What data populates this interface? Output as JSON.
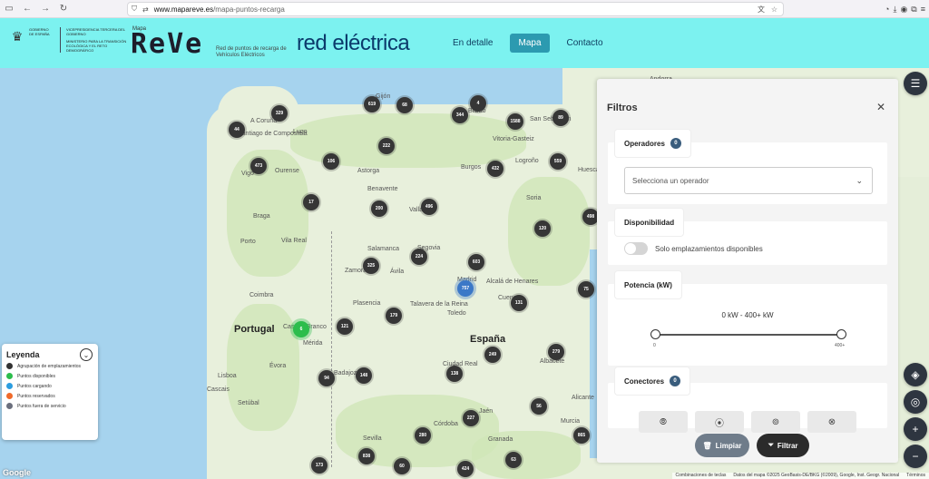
{
  "browser": {
    "url_host": "www.mapareve.es",
    "url_path": "/mapa-puntos-recarga"
  },
  "header": {
    "gov_text": "GOBIERNO DE ESPAÑA",
    "gov_sub": "VICEPRESIDENCIA TERCERA DEL GOBIERNO",
    "ministry": "MINISTERIO PARA LA TRANSICIÓN ECOLÓGICA Y EL RETO DEMOGRÁFICO",
    "mapa_label": "Mapa",
    "reve_logo": "ReVe",
    "reve_sub": "Red de puntos de recarga de Vehículos Eléctricos",
    "ree_logo": "red eléctrica",
    "nav": [
      {
        "label": "En detalle",
        "active": false
      },
      {
        "label": "Mapa",
        "active": true
      },
      {
        "label": "Contacto",
        "active": false
      }
    ]
  },
  "map": {
    "places": [
      {
        "name": "A Coruña",
        "big": false
      },
      {
        "name": "Santiago de Compostela",
        "big": false
      },
      {
        "name": "Lugo",
        "big": false
      },
      {
        "name": "Ourense",
        "big": false
      },
      {
        "name": "Vigo",
        "big": false
      },
      {
        "name": "Gijón",
        "big": false
      },
      {
        "name": "Astorga",
        "big": false
      },
      {
        "name": "Braga",
        "big": false
      },
      {
        "name": "Porto",
        "big": false
      },
      {
        "name": "Vila Real",
        "big": false
      },
      {
        "name": "Bilbao",
        "big": false
      },
      {
        "name": "San Sebastián",
        "big": false
      },
      {
        "name": "Vitoria-Gasteiz",
        "big": false
      },
      {
        "name": "Logroño",
        "big": false
      },
      {
        "name": "Burgos",
        "big": false
      },
      {
        "name": "Benavente",
        "big": false
      },
      {
        "name": "Salamanca",
        "big": false
      },
      {
        "name": "Zamora",
        "big": false
      },
      {
        "name": "Madrid",
        "big": false
      },
      {
        "name": "Alcalá de Henares",
        "big": false
      },
      {
        "name": "Toledo",
        "big": false
      },
      {
        "name": "Talavera de la Reina",
        "big": false
      },
      {
        "name": "Plasencia",
        "big": false
      },
      {
        "name": "Coimbra",
        "big": false
      },
      {
        "name": "Portugal",
        "big": true
      },
      {
        "name": "España",
        "big": true
      },
      {
        "name": "Castelo Branco",
        "big": false
      },
      {
        "name": "Ciudad Real",
        "big": false
      },
      {
        "name": "Albacete",
        "big": false
      },
      {
        "name": "Badajoz",
        "big": false
      },
      {
        "name": "Lisboa",
        "big": false
      },
      {
        "name": "Cascais",
        "big": false
      },
      {
        "name": "Setúbal",
        "big": false
      },
      {
        "name": "Évora",
        "big": false
      },
      {
        "name": "Córdoba",
        "big": false
      },
      {
        "name": "Jaén",
        "big": false
      },
      {
        "name": "Granada",
        "big": false
      },
      {
        "name": "Murcia",
        "big": false
      },
      {
        "name": "Sevilla",
        "big": false
      },
      {
        "name": "Alicante",
        "big": false
      },
      {
        "name": "Mérida",
        "big": false
      },
      {
        "name": "Valladolid",
        "big": false
      },
      {
        "name": "Segovia",
        "big": false
      },
      {
        "name": "Cuenca",
        "big": false
      },
      {
        "name": "Soria",
        "big": false
      },
      {
        "name": "Huesca",
        "big": false
      },
      {
        "name": "Andorra",
        "big": false
      },
      {
        "name": "Ávila",
        "big": false
      }
    ],
    "clusters": [
      {
        "label": "619",
        "kind": "dark"
      },
      {
        "label": "68",
        "kind": "dark"
      },
      {
        "label": "4",
        "kind": "dark"
      },
      {
        "label": "329",
        "kind": "dark"
      },
      {
        "label": "344",
        "kind": "dark"
      },
      {
        "label": "1588",
        "kind": "dark"
      },
      {
        "label": "89",
        "kind": "dark"
      },
      {
        "label": "44",
        "kind": "dark"
      },
      {
        "label": "222",
        "kind": "dark"
      },
      {
        "label": "473",
        "kind": "dark"
      },
      {
        "label": "106",
        "kind": "dark"
      },
      {
        "label": "432",
        "kind": "dark"
      },
      {
        "label": "559",
        "kind": "dark"
      },
      {
        "label": "17",
        "kind": "dark"
      },
      {
        "label": "200",
        "kind": "dark"
      },
      {
        "label": "496",
        "kind": "dark"
      },
      {
        "label": "498",
        "kind": "dark"
      },
      {
        "label": "120",
        "kind": "dark"
      },
      {
        "label": "224",
        "kind": "dark"
      },
      {
        "label": "325",
        "kind": "dark"
      },
      {
        "label": "603",
        "kind": "dark"
      },
      {
        "label": "757",
        "kind": "blue"
      },
      {
        "label": "131",
        "kind": "dark"
      },
      {
        "label": "75",
        "kind": "dark"
      },
      {
        "label": "179",
        "kind": "dark"
      },
      {
        "label": "121",
        "kind": "dark"
      },
      {
        "label": "6",
        "kind": "green"
      },
      {
        "label": "279",
        "kind": "dark"
      },
      {
        "label": "249",
        "kind": "dark"
      },
      {
        "label": "94",
        "kind": "dark"
      },
      {
        "label": "148",
        "kind": "dark"
      },
      {
        "label": "138",
        "kind": "dark"
      },
      {
        "label": "56",
        "kind": "dark"
      },
      {
        "label": "227",
        "kind": "dark"
      },
      {
        "label": "280",
        "kind": "dark"
      },
      {
        "label": "865",
        "kind": "dark"
      },
      {
        "label": "838",
        "kind": "dark"
      },
      {
        "label": "60",
        "kind": "dark"
      },
      {
        "label": "424",
        "kind": "dark"
      },
      {
        "label": "63",
        "kind": "dark"
      },
      {
        "label": "173",
        "kind": "dark"
      }
    ]
  },
  "legend": {
    "title": "Leyenda",
    "items": [
      {
        "label": "Agrupación de emplazamientos",
        "color": "#333333"
      },
      {
        "label": "Puntos disponibles",
        "color": "#2cbd4c"
      },
      {
        "label": "Puntos cargando",
        "color": "#2b9de0"
      },
      {
        "label": "Puntos reservados",
        "color": "#f06a2a"
      },
      {
        "label": "Puntos fuera de servicio",
        "color": "#6b6f7d"
      }
    ]
  },
  "filters": {
    "title": "Filtros",
    "operadores_label": "Operadores",
    "operadores_count": "0",
    "operadores_placeholder": "Selecciona un operador",
    "disponibilidad_label": "Disponibilidad",
    "disponibilidad_toggle_label": "Solo emplazamientos disponibles",
    "potencia_label": "Potencia (kW)",
    "potencia_range": "0 kW - 400+ kW",
    "potencia_min": "0",
    "potencia_max": "400+",
    "conectores_label": "Conectores",
    "conectores_count": "0",
    "limpiar": "Limpiar",
    "filtrar": "Filtrar"
  },
  "attribution": {
    "shortcuts": "Combinaciones de teclas",
    "data": "Datos del mapa ©2025 GeoBasis-DE/BKG (©2009), Google, Inst. Geogr. Nacional",
    "terms": "Términos",
    "google": "Google"
  }
}
